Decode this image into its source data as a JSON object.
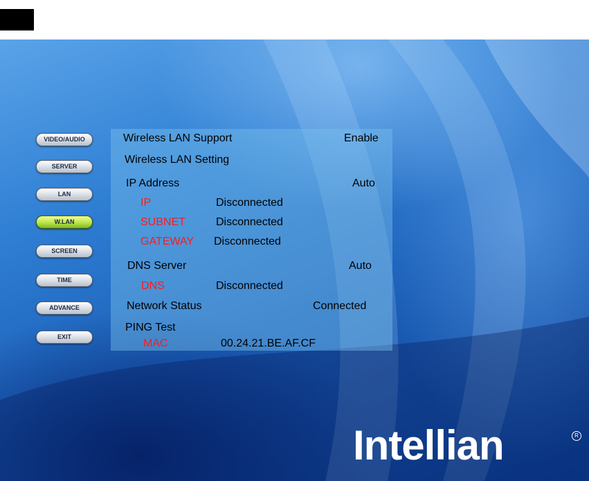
{
  "menu": {
    "items": [
      {
        "label": "VIDEO/AUDIO",
        "active": false
      },
      {
        "label": "SERVER",
        "active": false
      },
      {
        "label": "LAN",
        "active": false
      },
      {
        "label": "W.LAN",
        "active": true
      },
      {
        "label": "SCREEN",
        "active": false
      },
      {
        "label": "TIME",
        "active": false
      },
      {
        "label": "ADVANCE",
        "active": false
      },
      {
        "label": "EXIT",
        "active": false
      }
    ]
  },
  "wlan": {
    "support_label": "Wireless LAN Support",
    "support_value": "Enable",
    "setting_label": "Wireless LAN Setting",
    "ip_address_label": "IP Address",
    "ip_address_mode": "Auto",
    "ip_label": "IP",
    "ip_value": "Disconnected",
    "subnet_label": "SUBNET",
    "subnet_value": "Disconnected",
    "gateway_label": "GATEWAY",
    "gateway_value": "Disconnected",
    "dns_server_label": "DNS Server",
    "dns_server_mode": "Auto",
    "dns_label": "DNS",
    "dns_value": "Disconnected",
    "network_status_label": "Network Status",
    "network_status_value": "Connected",
    "ping_label": "PING Test",
    "mac_label": "MAC",
    "mac_value": "00.24.21.BE.AF.CF"
  },
  "brand": {
    "logo_text": "Intellian",
    "registered_mark": "R"
  },
  "colors": {
    "active_button": "#b9e44a",
    "label_red": "#ff1a1a",
    "background_blue": "#1b5fb8"
  }
}
